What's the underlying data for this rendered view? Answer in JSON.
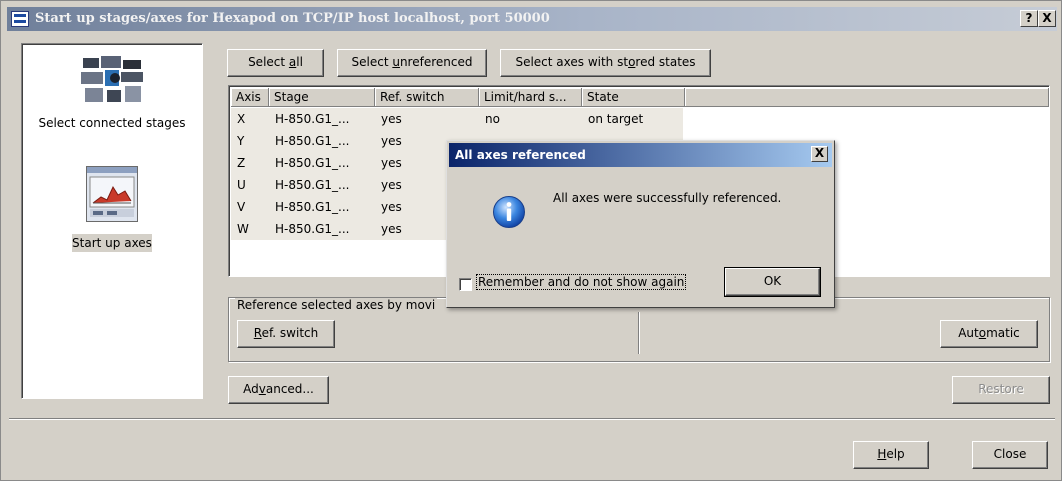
{
  "window": {
    "title": "Start up stages/axes for Hexapod on TCP/IP host localhost, port 50000",
    "help_glyph": "?",
    "close_glyph": "X"
  },
  "left_panel": {
    "items": [
      {
        "label": "Select connected stages"
      },
      {
        "label": "Start up axes"
      }
    ]
  },
  "toolbar": {
    "select_all": {
      "pre": "Select ",
      "u": "a",
      "post": "ll"
    },
    "select_unreferenced": {
      "pre": "Select ",
      "u": "u",
      "post": "nreferenced"
    },
    "select_stored": {
      "pre": "Select axes with st",
      "u": "o",
      "post": "red states"
    }
  },
  "table": {
    "columns": [
      "Axis",
      "Stage",
      "Ref. switch",
      "Limit/hard s...",
      "State"
    ],
    "rows": [
      {
        "axis": "X",
        "stage": "H-850.G1_...",
        "ref": "yes",
        "limit": "no",
        "state": "on target"
      },
      {
        "axis": "Y",
        "stage": "H-850.G1_...",
        "ref": "yes",
        "limit": "",
        "state": ""
      },
      {
        "axis": "Z",
        "stage": "H-850.G1_...",
        "ref": "yes",
        "limit": "",
        "state": ""
      },
      {
        "axis": "U",
        "stage": "H-850.G1_...",
        "ref": "yes",
        "limit": "",
        "state": ""
      },
      {
        "axis": "V",
        "stage": "H-850.G1_...",
        "ref": "yes",
        "limit": "",
        "state": ""
      },
      {
        "axis": "W",
        "stage": "H-850.G1_...",
        "ref": "yes",
        "limit": "",
        "state": ""
      }
    ]
  },
  "reference_group": {
    "title": "Reference selected axes by movi",
    "ref_switch": {
      "pre": "",
      "u": "R",
      "post": "ef. switch"
    },
    "automatic": {
      "pre": "Aut",
      "u": "o",
      "post": "matic"
    }
  },
  "bottom": {
    "advanced": {
      "pre": "Ad",
      "u": "v",
      "post": "anced..."
    },
    "restore": "Restore",
    "help": {
      "pre": "",
      "u": "H",
      "post": "elp"
    },
    "close": "Close"
  },
  "dialog": {
    "title": "All axes referenced",
    "message": "All axes were successfully referenced.",
    "checkbox_label": "Remember and do not show again",
    "checkbox_checked": false,
    "ok_label": "OK",
    "close_glyph": "X"
  },
  "colors": {
    "dialog_title_start": "#0a246a",
    "dialog_title_end": "#a6caf0",
    "info_icon": "#1f6fd0",
    "face": "#d4d0c8"
  }
}
